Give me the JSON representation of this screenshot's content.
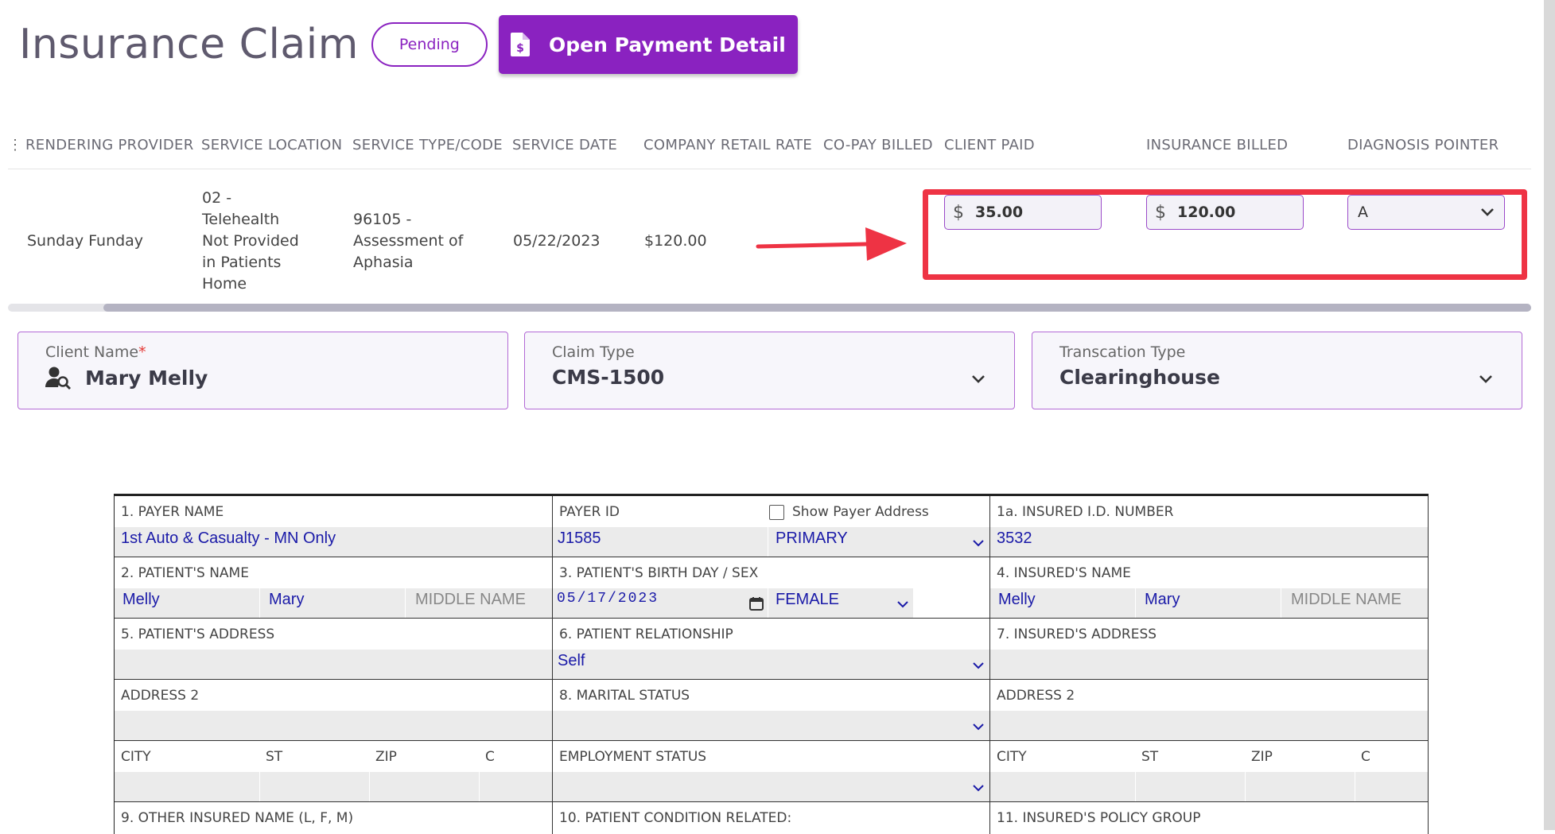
{
  "header": {
    "title": "Insurance Claim",
    "status_badge": "Pending",
    "payment_button": "Open Payment Detail"
  },
  "grid": {
    "columns": [
      "RENDERING PROVIDER",
      "SERVICE LOCATION",
      "SERVICE TYPE/CODE",
      "SERVICE DATE",
      "COMPANY RETAIL RATE",
      "CO-PAY BILLED",
      "CLIENT PAID",
      "INSURANCE BILLED",
      "DIAGNOSIS POINTER"
    ],
    "row": {
      "rendering_provider": "Sunday Funday",
      "service_location": [
        "02 -",
        "Telehealth",
        "Not Provided",
        "in Patients",
        "Home"
      ],
      "service_type": [
        "96105 -",
        "Assessment of",
        "Aphasia"
      ],
      "service_date": "05/22/2023",
      "retail_rate": "$120.00",
      "client_paid": {
        "currency": "$",
        "value": "35.00"
      },
      "insurance_billed": {
        "currency": "$",
        "value": "120.00"
      },
      "diagnosis_pointer": "A"
    }
  },
  "fields": {
    "client_name": {
      "label": "Client Name",
      "required_mark": "*",
      "value": "Mary Melly"
    },
    "claim_type": {
      "label": "Claim Type",
      "value": "CMS-1500"
    },
    "transaction_type": {
      "label": "Transcation Type",
      "value": "Clearinghouse"
    }
  },
  "form": {
    "payer_name": {
      "label": "1. PAYER NAME",
      "value": "1st Auto & Casualty - MN Only"
    },
    "payer_id": {
      "label": "PAYER ID",
      "value": "J1585"
    },
    "show_payer_address": "Show Payer Address",
    "payer_priority": "PRIMARY",
    "insured_id": {
      "label": "1a. INSURED I.D. NUMBER",
      "value": "3532"
    },
    "patient_name": {
      "label": "2. PATIENT'S NAME",
      "last": "Melly",
      "first": "Mary",
      "middle_placeholder": "MIDDLE NAME"
    },
    "birth": {
      "label": "3. PATIENT'S BIRTH DAY / SEX",
      "date": "05/17/2023",
      "sex": "FEMALE"
    },
    "insured_name": {
      "label": "4. INSURED'S NAME",
      "last": "Melly",
      "first": "Mary",
      "middle_placeholder": "MIDDLE NAME"
    },
    "patient_address": {
      "label": "5. PATIENT'S ADDRESS"
    },
    "relationship": {
      "label": "6. PATIENT RELATIONSHIP",
      "value": "Self"
    },
    "insured_address": {
      "label": "7. INSURED'S ADDRESS"
    },
    "address2_left": {
      "label": "ADDRESS 2"
    },
    "marital_status": {
      "label": "8. MARITAL STATUS"
    },
    "address2_right": {
      "label": "ADDRESS 2"
    },
    "city": "CITY",
    "st": "ST",
    "zip": "ZIP",
    "c": "C",
    "employment_status": {
      "label": "EMPLOYMENT STATUS"
    },
    "other_insured": {
      "label": "9. OTHER INSURED NAME (L, F, M)"
    },
    "condition_related": {
      "label": "10. PATIENT CONDITION RELATED:"
    },
    "policy_group": {
      "label": "11. INSURED'S POLICY GROUP"
    }
  }
}
